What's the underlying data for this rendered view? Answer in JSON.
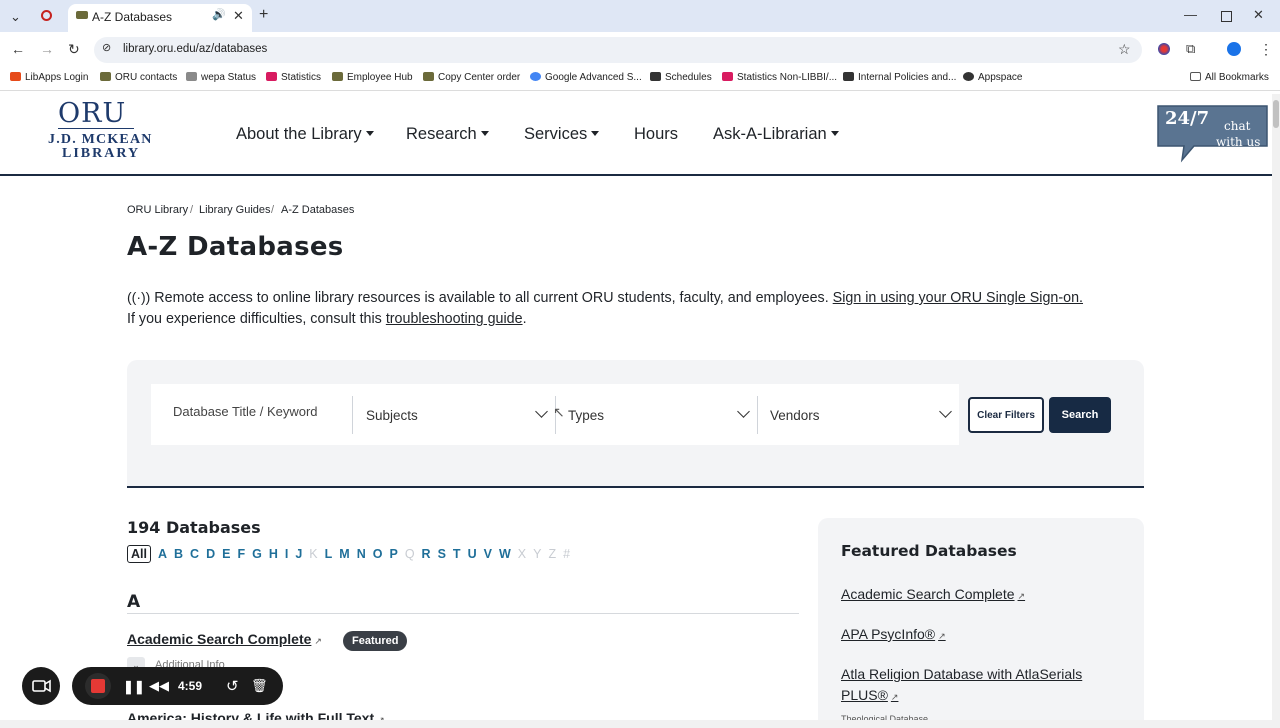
{
  "browser": {
    "tab_title": "A-Z Databases",
    "url": "library.oru.edu/az/databases",
    "bookmarks": [
      "LibApps Login",
      "ORU contacts",
      "wepa Status",
      "Statistics",
      "Employee Hub",
      "Copy Center order",
      "Google Advanced S...",
      "Schedules",
      "Statistics Non-LIBBI/...",
      "Internal Policies and...",
      "Appspace"
    ],
    "all_bookmarks": "All Bookmarks"
  },
  "site": {
    "logo_oru": "ORU",
    "logo_line1": "J.D. MCKEAN",
    "logo_line2": "LIBRARY",
    "nav": [
      "About the Library",
      "Research",
      "Services",
      "Hours",
      "Ask-A-Librarian"
    ],
    "chat_line1": "24/7",
    "chat_line2": "chat",
    "chat_line3": "with us"
  },
  "breadcrumb": [
    "ORU Library",
    "Library Guides",
    "A-Z Databases"
  ],
  "page": {
    "title": "A-Z Databases",
    "notice_text": "Remote access to online library resources is available to all current ORU students, faculty, and employees.",
    "notice_link": "Sign in using your ORU Single Sign-on.",
    "notice2_text": "If you experience difficulties, consult this",
    "notice2_link": "troubleshooting guide",
    "notice2_end": "."
  },
  "search": {
    "keyword_placeholder": "Database Title / Keyword",
    "subjects": "Subjects",
    "types": "Types",
    "vendors": "Vendors",
    "clear_label": "Clear Filters",
    "search_label": "Search"
  },
  "results": {
    "count": "194 Databases",
    "letters": [
      {
        "l": "All",
        "state": "active"
      },
      {
        "l": "A",
        "state": "on"
      },
      {
        "l": "B",
        "state": "on"
      },
      {
        "l": "C",
        "state": "on"
      },
      {
        "l": "D",
        "state": "on"
      },
      {
        "l": "E",
        "state": "on"
      },
      {
        "l": "F",
        "state": "on"
      },
      {
        "l": "G",
        "state": "on"
      },
      {
        "l": "H",
        "state": "on"
      },
      {
        "l": "I",
        "state": "on"
      },
      {
        "l": "J",
        "state": "on"
      },
      {
        "l": "K",
        "state": "off"
      },
      {
        "l": "L",
        "state": "on"
      },
      {
        "l": "M",
        "state": "on"
      },
      {
        "l": "N",
        "state": "on"
      },
      {
        "l": "O",
        "state": "on"
      },
      {
        "l": "P",
        "state": "on"
      },
      {
        "l": "Q",
        "state": "off"
      },
      {
        "l": "R",
        "state": "on"
      },
      {
        "l": "S",
        "state": "on"
      },
      {
        "l": "T",
        "state": "on"
      },
      {
        "l": "U",
        "state": "on"
      },
      {
        "l": "V",
        "state": "on"
      },
      {
        "l": "W",
        "state": "on"
      },
      {
        "l": "X",
        "state": "off"
      },
      {
        "l": "Y",
        "state": "off"
      },
      {
        "l": "Z",
        "state": "off"
      },
      {
        "l": "#",
        "state": "off"
      }
    ],
    "section": "A",
    "item1": "Academic Search Complete",
    "item1_badge": "Featured",
    "item1_more": "Additional Info",
    "item2": "America: History & Life with Full Text"
  },
  "featured": {
    "title": "Featured Databases",
    "items": [
      "Academic Search Complete",
      "APA PsycInfo®",
      "Atla Religion Database with AtlaSerials PLUS®"
    ],
    "item3_sub": "Theological Database"
  },
  "recorder": {
    "time": "4:59"
  }
}
